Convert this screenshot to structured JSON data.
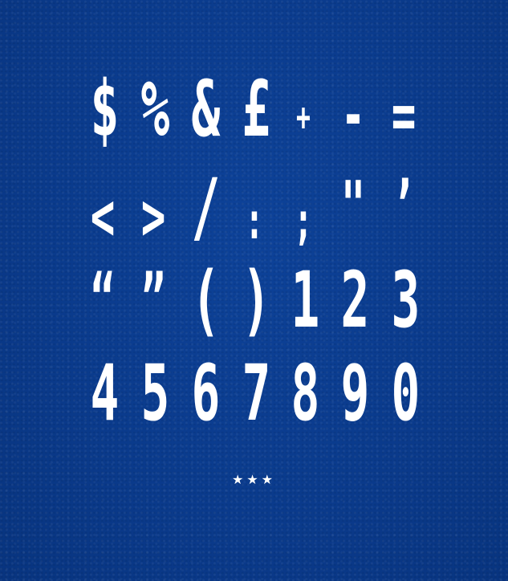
{
  "background_color": "#0b3c8f",
  "glyph_color": "#ffffff",
  "rows": [
    {
      "glyphs": [
        "$",
        "%",
        "&",
        "£",
        "+",
        "-",
        "="
      ]
    },
    {
      "glyphs": [
        "<",
        ">",
        "/",
        ":",
        ";",
        "\"",
        "’"
      ]
    },
    {
      "glyphs": [
        "“",
        "”",
        "(",
        ")",
        "1",
        "2",
        "3"
      ]
    },
    {
      "glyphs": [
        "4",
        "5",
        "6",
        "7",
        "8",
        "9",
        "0"
      ]
    }
  ],
  "ornament": "★★★"
}
